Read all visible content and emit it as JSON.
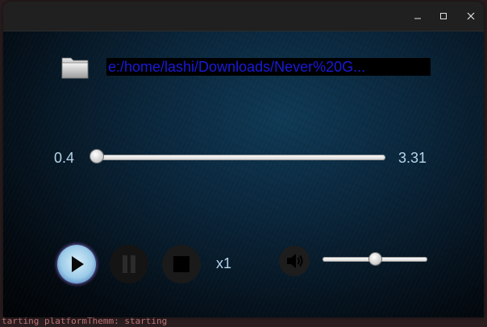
{
  "background_terminal": {
    "text": "tarting platformThemm: starting"
  },
  "window": {
    "titlebar": {
      "minimize_icon": "minimize-icon",
      "maximize_icon": "maximize-icon",
      "close_icon": "close-icon"
    }
  },
  "player": {
    "file_path": "e:/home/lashi/Downloads/Never%20G...",
    "folder_icon": "folder-icon",
    "time_current": "0.4",
    "time_total": "3.31",
    "seek_fraction": 0.0,
    "speed_label": "x1",
    "volume_fraction": 0.5,
    "colors": {
      "path_text": "#1a1adc",
      "label_text": "#b6d4ea",
      "play_glow": "#6b59b8"
    },
    "controls": {
      "play_icon": "play-icon",
      "pause_icon": "pause-icon",
      "stop_icon": "stop-icon",
      "volume_icon": "speaker-icon"
    }
  }
}
